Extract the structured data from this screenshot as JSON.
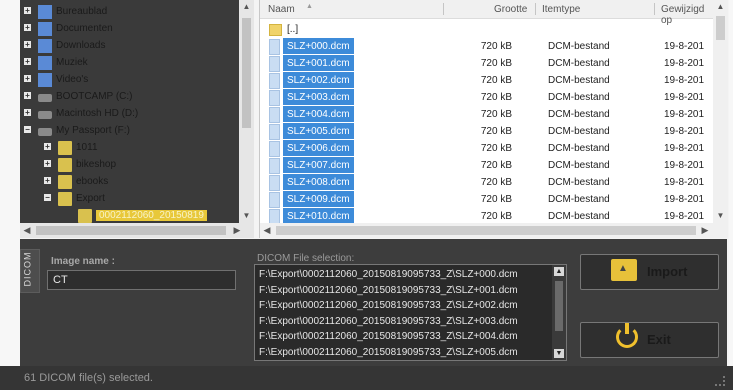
{
  "tree": {
    "items": [
      {
        "label": "Bureaublad",
        "icon": "desktop-folder-icon",
        "expander": "+"
      },
      {
        "label": "Documenten",
        "icon": "documents-folder-icon",
        "expander": "+"
      },
      {
        "label": "Downloads",
        "icon": "downloads-folder-icon",
        "expander": "+"
      },
      {
        "label": "Muziek",
        "icon": "music-folder-icon",
        "expander": "+"
      },
      {
        "label": "Video's",
        "icon": "videos-folder-icon",
        "expander": "+"
      },
      {
        "label": "BOOTCAMP (C:)",
        "icon": "drive-icon",
        "expander": "+"
      },
      {
        "label": "Macintosh HD (D:)",
        "icon": "drive-icon",
        "expander": "+"
      },
      {
        "label": "My Passport (F:)",
        "icon": "drive-icon",
        "expander": "−"
      },
      {
        "label": "1011",
        "icon": "folder-icon",
        "expander": "+"
      },
      {
        "label": "bikeshop",
        "icon": "folder-icon",
        "expander": "+"
      },
      {
        "label": "ebooks",
        "icon": "folder-icon",
        "expander": "+"
      },
      {
        "label": "Export",
        "icon": "folder-icon",
        "expander": "−"
      },
      {
        "label": "0002112060_20150819",
        "icon": "folder-icon",
        "expander": ""
      }
    ]
  },
  "files": {
    "columns": {
      "name": "Naam",
      "size": "Grootte",
      "type": "Itemtype",
      "modified": "Gewijzigd op"
    },
    "parent": "[..]",
    "rows": [
      {
        "name": "SLZ+000.dcm",
        "size": "720 kB",
        "type": "DCM-bestand",
        "date": "19-8-201"
      },
      {
        "name": "SLZ+001.dcm",
        "size": "720 kB",
        "type": "DCM-bestand",
        "date": "19-8-201"
      },
      {
        "name": "SLZ+002.dcm",
        "size": "720 kB",
        "type": "DCM-bestand",
        "date": "19-8-201"
      },
      {
        "name": "SLZ+003.dcm",
        "size": "720 kB",
        "type": "DCM-bestand",
        "date": "19-8-201"
      },
      {
        "name": "SLZ+004.dcm",
        "size": "720 kB",
        "type": "DCM-bestand",
        "date": "19-8-201"
      },
      {
        "name": "SLZ+005.dcm",
        "size": "720 kB",
        "type": "DCM-bestand",
        "date": "19-8-201"
      },
      {
        "name": "SLZ+006.dcm",
        "size": "720 kB",
        "type": "DCM-bestand",
        "date": "19-8-201"
      },
      {
        "name": "SLZ+007.dcm",
        "size": "720 kB",
        "type": "DCM-bestand",
        "date": "19-8-201"
      },
      {
        "name": "SLZ+008.dcm",
        "size": "720 kB",
        "type": "DCM-bestand",
        "date": "19-8-201"
      },
      {
        "name": "SLZ+009.dcm",
        "size": "720 kB",
        "type": "DCM-bestand",
        "date": "19-8-201"
      },
      {
        "name": "SLZ+010.dcm",
        "size": "720 kB",
        "type": "DCM-bestand",
        "date": "19-8-201"
      }
    ]
  },
  "panel": {
    "tab_label": "DICOM",
    "image_name_label": "Image name :",
    "image_name_value": "CT",
    "selection_label": "DICOM File selection:",
    "selection_items": [
      "F:\\Export\\0002112060_20150819095733_Z\\SLZ+000.dcm",
      "F:\\Export\\0002112060_20150819095733_Z\\SLZ+001.dcm",
      "F:\\Export\\0002112060_20150819095733_Z\\SLZ+002.dcm",
      "F:\\Export\\0002112060_20150819095733_Z\\SLZ+003.dcm",
      "F:\\Export\\0002112060_20150819095733_Z\\SLZ+004.dcm",
      "F:\\Export\\0002112060_20150819095733_Z\\SLZ+005.dcm"
    ],
    "import_label": "Import",
    "exit_label": "Exit"
  },
  "status": {
    "text": "61 DICOM file(s) selected."
  },
  "colors": {
    "selection_blue": "#3d8bd9",
    "accent_yellow": "#f0c02d",
    "panel_dark": "#3d3d3d"
  }
}
